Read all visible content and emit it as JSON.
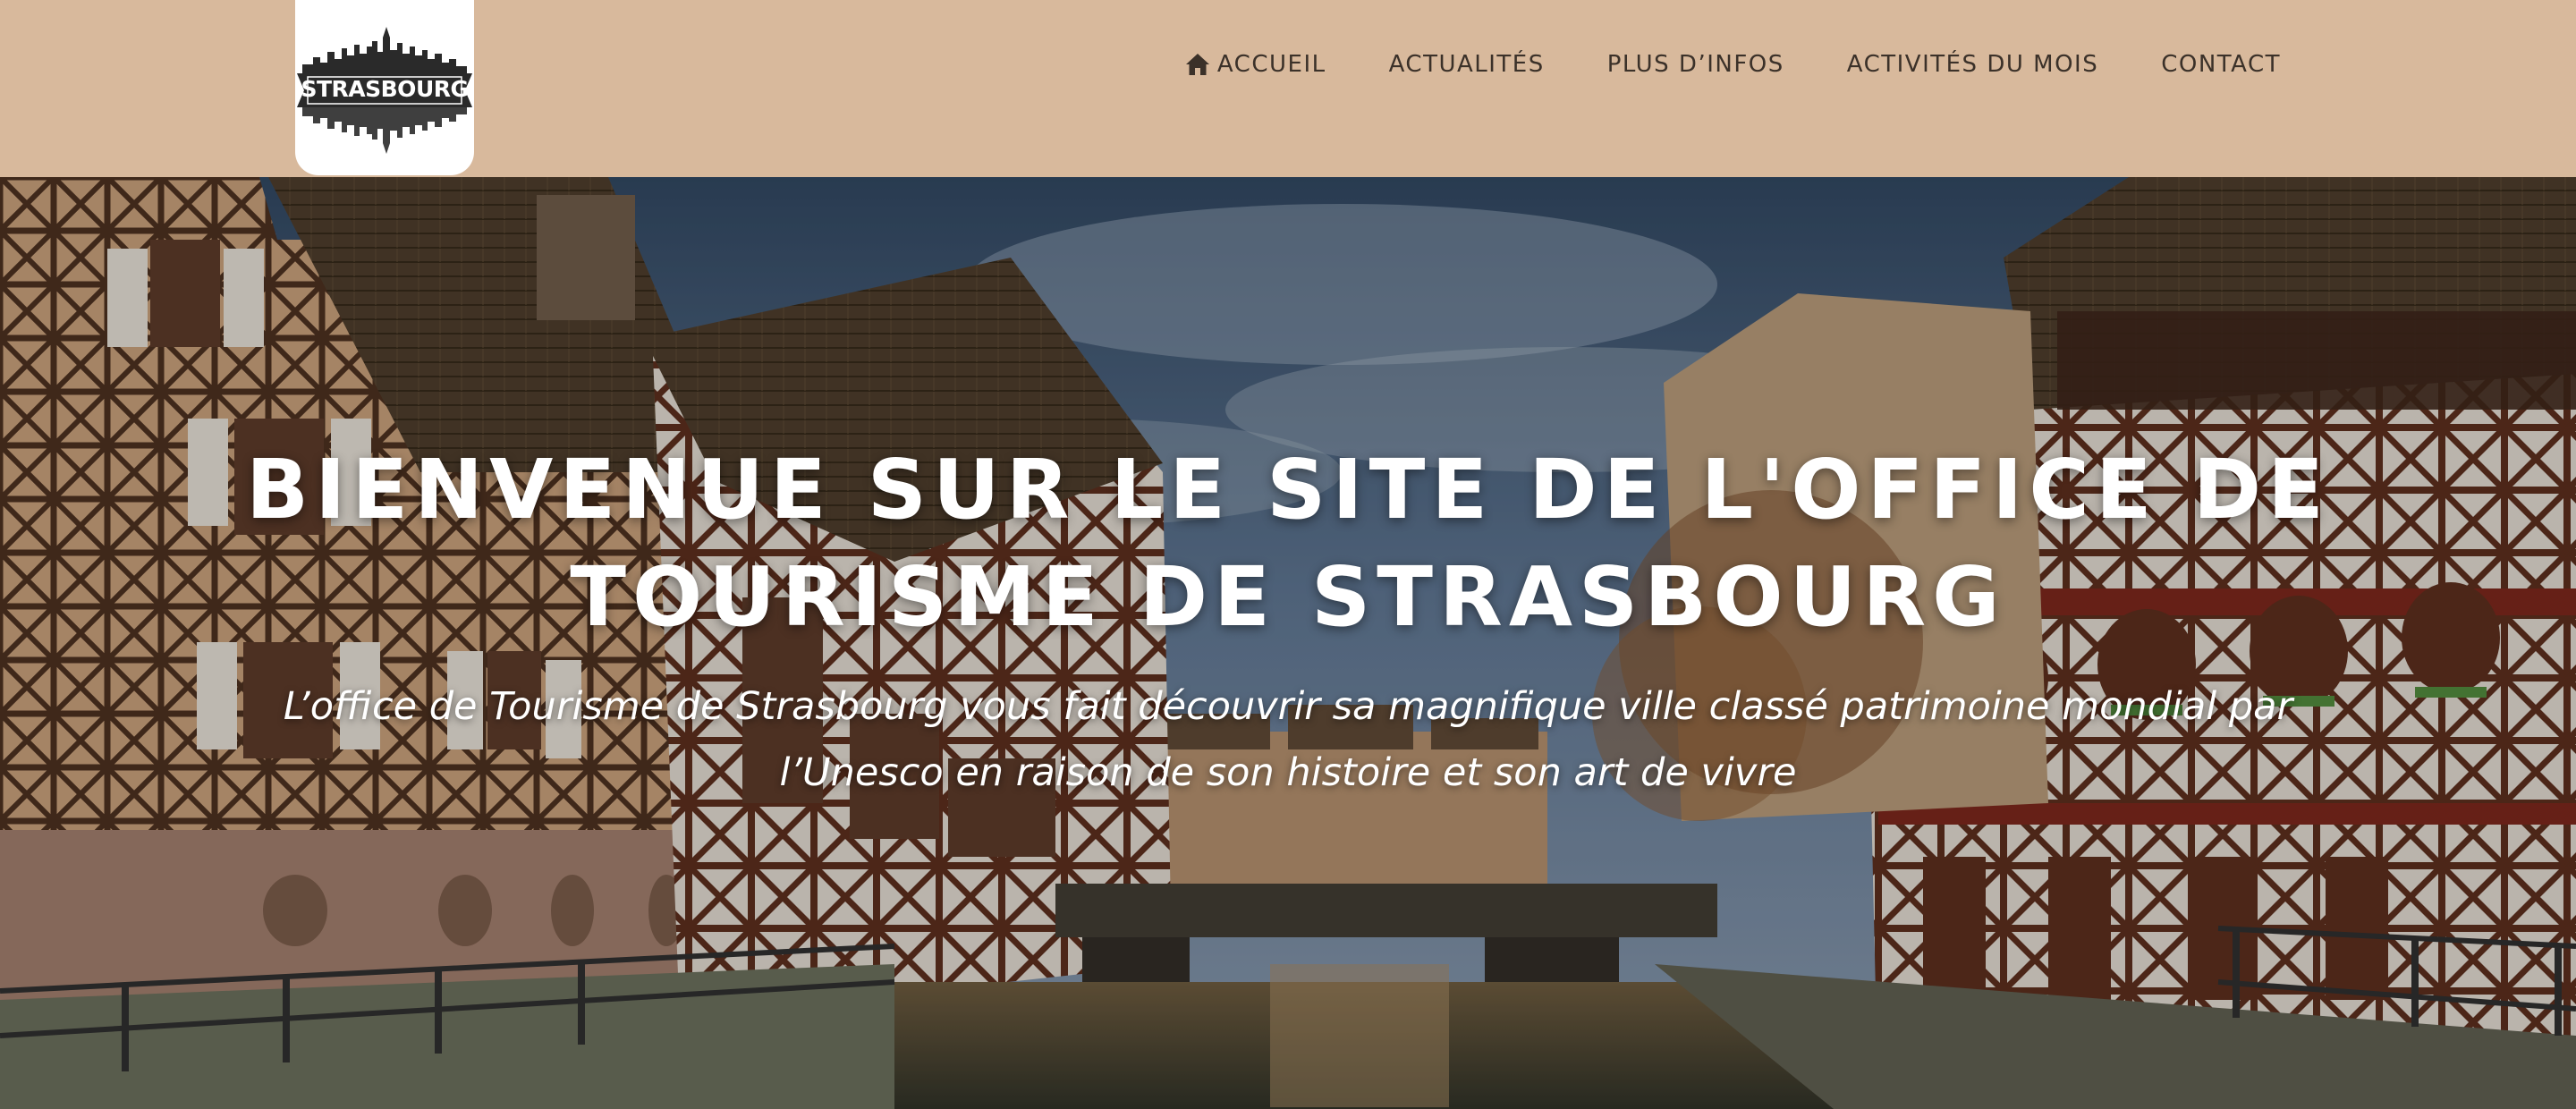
{
  "logo": {
    "text": "STRASBOURG"
  },
  "nav": {
    "items": [
      {
        "label": "ACCUEIL",
        "icon": "home-icon"
      },
      {
        "label": "ACTUALITÉS"
      },
      {
        "label": "PLUS D’INFOS"
      },
      {
        "label": "ACTIVITÉS DU MOIS"
      },
      {
        "label": "CONTACT"
      }
    ]
  },
  "hero": {
    "title": "BIENVENUE SUR LE SITE DE L'OFFICE DE TOURISME DE STRASBOURG",
    "subtitle": "L’office de Tourisme de Strasbourg vous fait découvrir sa magnifique ville classé patrimoine mondial par l’Unesco en raison de son histoire et son art de vivre"
  },
  "colors": {
    "header_bg": "#d8b99c",
    "nav_text": "#3b3129",
    "hero_text": "#ffffff"
  }
}
